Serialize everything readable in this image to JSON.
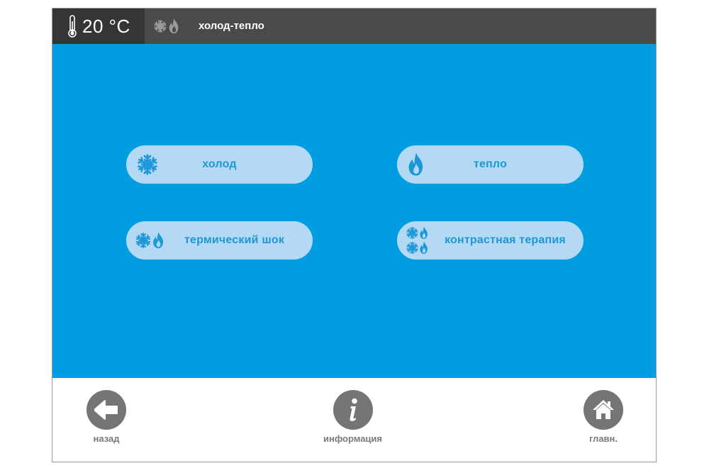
{
  "header": {
    "temperature": "20 °C",
    "mode_title": "холод-тепло",
    "icons": [
      "thermometer-icon",
      "snowflake-icon",
      "flame-icon"
    ]
  },
  "modes": [
    {
      "id": "cold",
      "label": "холод",
      "icon": "snowflake"
    },
    {
      "id": "warm",
      "label": "тепло",
      "icon": "flame"
    },
    {
      "id": "thermal-shock",
      "label": "термический шок",
      "icon": "snowflake-flame"
    },
    {
      "id": "contrast-therapy",
      "label": "контрастная терапия",
      "icon": "snowflake-flame-double"
    }
  ],
  "footer": {
    "back_label": "назад",
    "info_label": "информация",
    "home_label": "главн."
  },
  "colors": {
    "header_bg": "#4a4a4a",
    "temp_bg": "#353535",
    "main_bg": "#009ee1",
    "button_bg": "#b3d9f5",
    "button_text": "#1c98d6",
    "nav_circle": "#757575",
    "nav_text": "#7a7a7a"
  }
}
